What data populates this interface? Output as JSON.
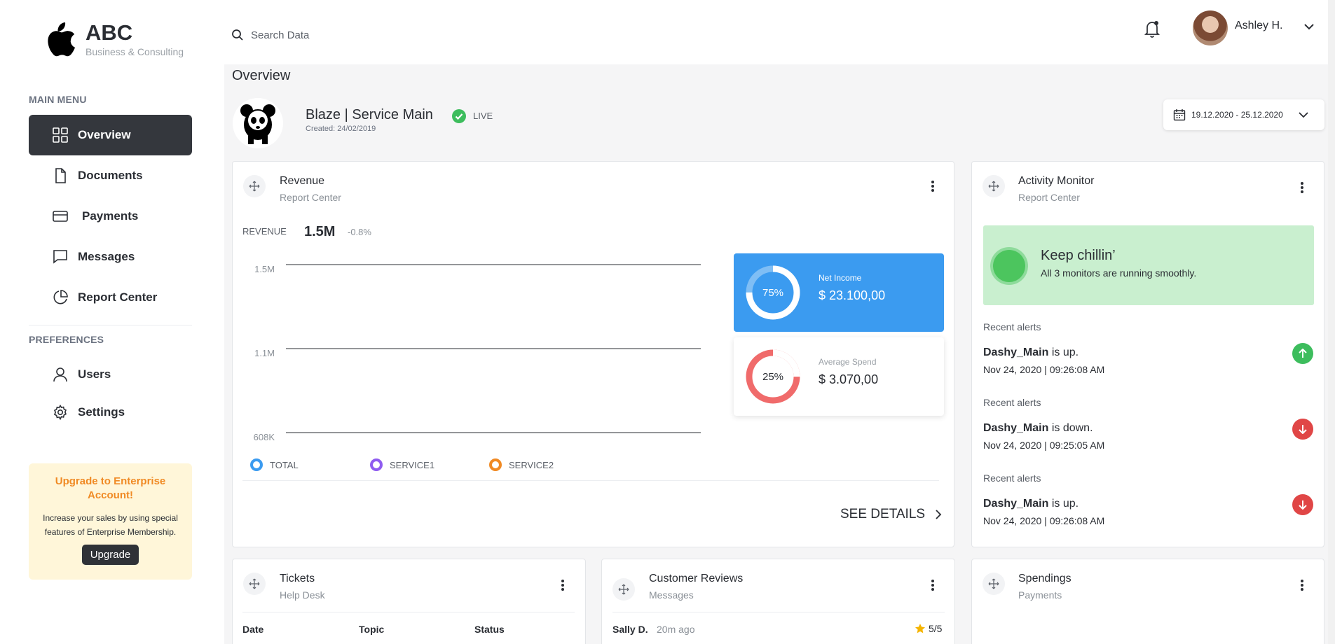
{
  "brand": {
    "name": "ABC",
    "subtitle": "Business & Consulting",
    "logo_icon": "apple-icon"
  },
  "sidebar": {
    "main_menu_title": "MAIN MENU",
    "main_items": [
      {
        "label": "Overview",
        "icon": "grid-icon",
        "active": true
      },
      {
        "label": "Documents",
        "icon": "document-icon"
      },
      {
        "label": "Payments",
        "icon": "credit-card-icon"
      },
      {
        "label": "Messages",
        "icon": "message-icon"
      },
      {
        "label": "Report Center",
        "icon": "pie-chart-icon"
      }
    ],
    "preferences_title": "PREFERENCES",
    "pref_items": [
      {
        "label": "Users",
        "icon": "user-icon"
      },
      {
        "label": "Settings",
        "icon": "gear-icon"
      }
    ],
    "upgrade": {
      "title": "Upgrade to Enterprise Account!",
      "text": "Increase your sales by using special features of Enterprise Membership.",
      "button": "Upgrade"
    }
  },
  "topbar": {
    "search_placeholder": "Search Data",
    "user_name": "Ashley H."
  },
  "page": {
    "title": "Overview",
    "service_name": "Blaze | Service Main",
    "service_created": "Created: 24/02/2019",
    "status": "LIVE",
    "date_range": "19.12.2020 - 25.12.2020"
  },
  "revenue_card": {
    "title": "Revenue",
    "subtitle": "Report Center",
    "label": "REVENUE",
    "value": "1.5M",
    "change": "-0.8%",
    "see_details": "SEE DETAILS",
    "net_income": {
      "title": "Net Income",
      "value": "$ 23.100,00",
      "percent_label": "75%",
      "percent": 0.75
    },
    "average_spend": {
      "title": "Average Spend",
      "value": "$ 3.070,00",
      "percent_label": "25%",
      "percent": 0.25
    }
  },
  "chart_data": {
    "type": "line",
    "title": "",
    "xlabel": "",
    "ylabel": "",
    "y_ticks": [
      "1.5M",
      "1.1M",
      "608K"
    ],
    "grid": true,
    "legend": "bottom-left",
    "series": [
      {
        "name": "TOTAL",
        "color": "#3b9bf0",
        "values": []
      },
      {
        "name": "SERVICE1",
        "color": "#8f5cf0",
        "values": []
      },
      {
        "name": "SERVICE2",
        "color": "#f08a24",
        "values": []
      }
    ]
  },
  "activity_card": {
    "title": "Activity Monitor",
    "subtitle": "Report Center",
    "chill_title": "Keep chillin’",
    "chill_text": "All 3 monitors are running smoothly.",
    "alerts": [
      {
        "label": "Recent alerts",
        "name": "Dashy_Main",
        "status_text": "is up.",
        "time": "Nov 24, 2020 | 09:26:08 AM",
        "direction": "up",
        "icon": "arrow-up-icon",
        "color": "#3dbd5d"
      },
      {
        "label": "Recent alerts",
        "name": "Dashy_Main",
        "status_text": "is down.",
        "time": "Nov 24, 2020 | 09:25:05 AM",
        "direction": "down",
        "icon": "arrow-down-icon",
        "color": "#e04646"
      },
      {
        "label": "Recent alerts",
        "name": "Dashy_Main",
        "status_text": "is up.",
        "time": "Nov 24, 2020 | 09:26:08 AM",
        "direction": "down",
        "icon": "arrow-down-icon",
        "color": "#e04646"
      }
    ]
  },
  "tickets_card": {
    "title": "Tickets",
    "subtitle": "Help Desk",
    "columns": [
      "Date",
      "Topic",
      "Status"
    ]
  },
  "reviews_card": {
    "title": "Customer Reviews",
    "subtitle": "Messages",
    "review": {
      "name": "Sally D.",
      "time": "20m ago",
      "rating": "5/5"
    }
  },
  "spendings_card": {
    "title": "Spendings",
    "subtitle": "Payments"
  }
}
